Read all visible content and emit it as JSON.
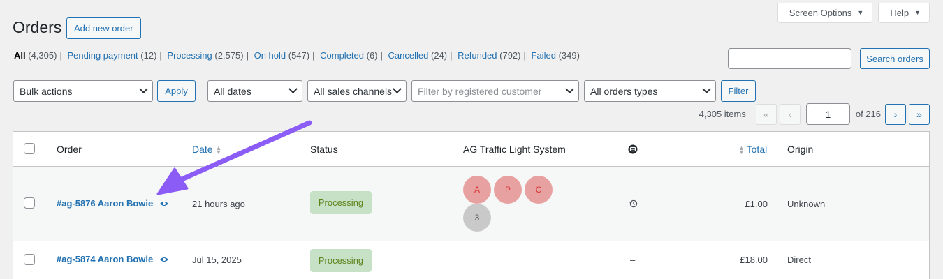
{
  "screen_options": {
    "screen_options_label": "Screen Options",
    "help_label": "Help"
  },
  "header": {
    "title": "Orders",
    "add_new_label": "Add new order"
  },
  "status_filters": [
    {
      "label": "All",
      "count": "(4,305)"
    },
    {
      "label": "Pending payment",
      "count": "(12)"
    },
    {
      "label": "Processing",
      "count": "(2,575)"
    },
    {
      "label": "On hold",
      "count": "(547)"
    },
    {
      "label": "Completed",
      "count": "(6)"
    },
    {
      "label": "Cancelled",
      "count": "(24)"
    },
    {
      "label": "Refunded",
      "count": "(792)"
    },
    {
      "label": "Failed",
      "count": "(349)"
    }
  ],
  "search": {
    "value": "",
    "button_label": "Search orders"
  },
  "filters": {
    "bulk_actions": "Bulk actions",
    "apply_label": "Apply",
    "dates": "All dates",
    "sales_channels": "All sales channels",
    "customer_placeholder": "Filter by registered customer",
    "order_types": "All orders types",
    "filter_label": "Filter"
  },
  "pagination": {
    "items": "4,305 items",
    "first": "«",
    "prev": "‹",
    "current_page": "1",
    "of_pages": "of 216",
    "next": "›",
    "last": "»"
  },
  "table": {
    "columns": {
      "order": "Order",
      "date": "Date",
      "status": "Status",
      "traffic": "AG Traffic Light System",
      "total": "Total",
      "origin": "Origin"
    },
    "rows": [
      {
        "order": "#ag-5876 Aaron Bowie",
        "date": "21 hours ago",
        "status": "Processing",
        "traffic": [
          "A",
          "P",
          "C",
          "3"
        ],
        "attribution_icon": "history-icon",
        "total": "£1.00",
        "origin": "Unknown"
      },
      {
        "order": "#ag-5874 Aaron Bowie",
        "date": "Jul 15, 2025",
        "status": "Processing",
        "traffic": [],
        "attribution": "–",
        "total": "£18.00",
        "origin": "Direct"
      }
    ]
  },
  "colors": {
    "link": "#2271b1",
    "status_processing_bg": "#c6e1c6",
    "status_processing_text": "#5b841b",
    "traffic_red": "#e8a1a1",
    "traffic_grey": "#c9c9c9",
    "annotation_arrow": "#8b5cf6"
  }
}
